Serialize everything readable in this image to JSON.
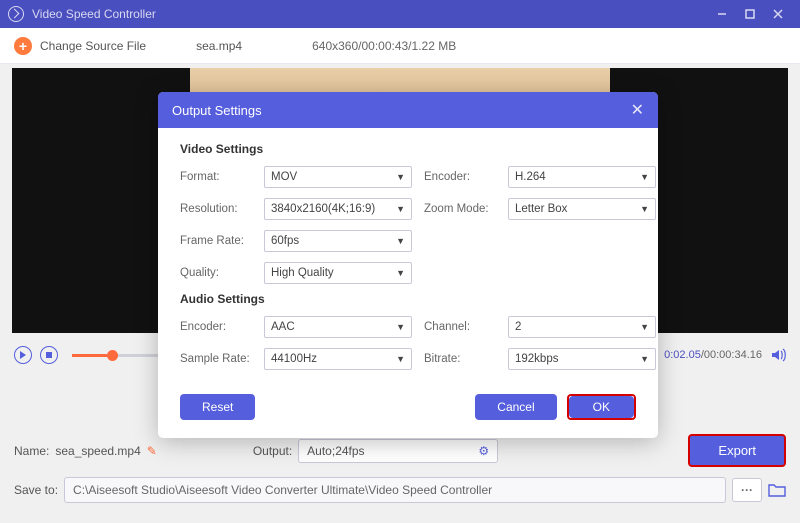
{
  "titlebar": {
    "title": "Video Speed Controller"
  },
  "topbar": {
    "change_source": "Change Source File",
    "filename": "sea.mp4",
    "fileinfo": "640x360/00:00:43/1.22 MB"
  },
  "playback": {
    "current": "0:02.05",
    "total": "00:00:34.16"
  },
  "dialog": {
    "title": "Output Settings",
    "video_section": "Video Settings",
    "audio_section": "Audio Settings",
    "labels": {
      "format": "Format:",
      "encoder": "Encoder:",
      "resolution": "Resolution:",
      "zoom": "Zoom Mode:",
      "framerate": "Frame Rate:",
      "quality": "Quality:",
      "aencoder": "Encoder:",
      "channel": "Channel:",
      "samplerate": "Sample Rate:",
      "bitrate": "Bitrate:"
    },
    "values": {
      "format": "MOV",
      "encoder": "H.264",
      "resolution": "3840x2160(4K;16:9)",
      "zoom": "Letter Box",
      "framerate": "60fps",
      "quality": "High Quality",
      "aencoder": "AAC",
      "channel": "2",
      "samplerate": "44100Hz",
      "bitrate": "192kbps"
    },
    "buttons": {
      "reset": "Reset",
      "cancel": "Cancel",
      "ok": "OK"
    }
  },
  "bottom": {
    "name_label": "Name:",
    "name_value": "sea_speed.mp4",
    "output_label": "Output:",
    "output_value": "Auto;24fps",
    "saveto_label": "Save to:",
    "saveto_value": "C:\\Aiseesoft Studio\\Aiseesoft Video Converter Ultimate\\Video Speed Controller",
    "export": "Export"
  }
}
